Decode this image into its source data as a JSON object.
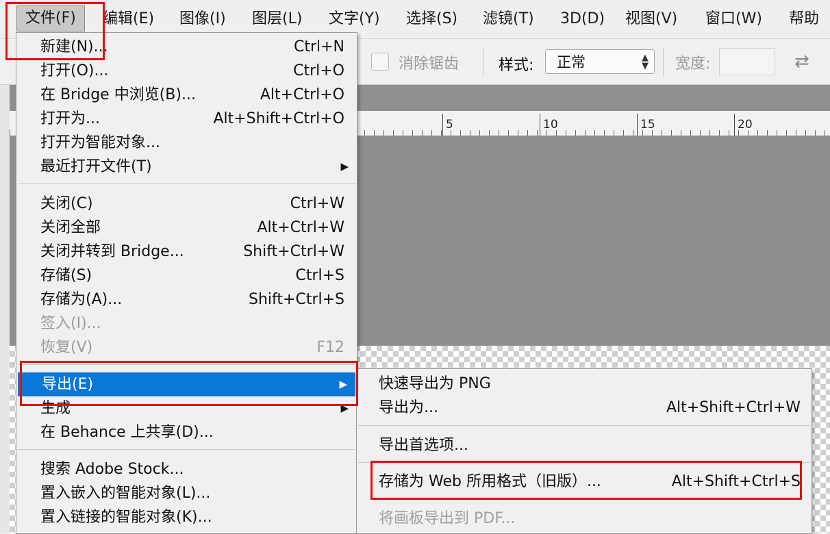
{
  "menubar": {
    "items": [
      {
        "label": "文件(F)"
      },
      {
        "label": "编辑(E)"
      },
      {
        "label": "图像(I)"
      },
      {
        "label": "图层(L)"
      },
      {
        "label": "文字(Y)"
      },
      {
        "label": "选择(S)"
      },
      {
        "label": "滤镜(T)"
      },
      {
        "label": "3D(D)"
      },
      {
        "label": "视图(V)"
      },
      {
        "label": "窗口(W)"
      },
      {
        "label": "帮助"
      }
    ]
  },
  "options": {
    "anti_alias_label": "消除锯齿",
    "anti_alias_checked": false,
    "style_label": "样式:",
    "style_value": "正常",
    "width_label": "宽度:",
    "width_value": ""
  },
  "ruler": {
    "labels": [
      "5",
      "10",
      "15",
      "20"
    ]
  },
  "file_menu": {
    "items": [
      {
        "label": "新建(N)...",
        "shortcut": "Ctrl+N"
      },
      {
        "label": "打开(O)...",
        "shortcut": "Ctrl+O"
      },
      {
        "label": "在 Bridge 中浏览(B)...",
        "shortcut": "Alt+Ctrl+O"
      },
      {
        "label": "打开为...",
        "shortcut": "Alt+Shift+Ctrl+O"
      },
      {
        "label": "打开为智能对象...",
        "shortcut": ""
      },
      {
        "label": "最近打开文件(T)",
        "shortcut": ""
      },
      {
        "label": "关闭(C)",
        "shortcut": "Ctrl+W"
      },
      {
        "label": "关闭全部",
        "shortcut": "Alt+Ctrl+W"
      },
      {
        "label": "关闭并转到 Bridge...",
        "shortcut": "Shift+Ctrl+W"
      },
      {
        "label": "存储(S)",
        "shortcut": "Ctrl+S"
      },
      {
        "label": "存储为(A)...",
        "shortcut": "Shift+Ctrl+S"
      },
      {
        "label": "签入(I)...",
        "shortcut": ""
      },
      {
        "label": "恢复(V)",
        "shortcut": "F12"
      },
      {
        "label": "导出(E)",
        "shortcut": ""
      },
      {
        "label": "生成",
        "shortcut": ""
      },
      {
        "label": "在 Behance 上共享(D)...",
        "shortcut": ""
      },
      {
        "label": "搜索 Adobe Stock...",
        "shortcut": ""
      },
      {
        "label": "置入嵌入的智能对象(L)...",
        "shortcut": ""
      },
      {
        "label": "置入链接的智能对象(K)...",
        "shortcut": ""
      }
    ]
  },
  "export_submenu": {
    "items": [
      {
        "label": "快速导出为 PNG",
        "shortcut": ""
      },
      {
        "label": "导出为...",
        "shortcut": "Alt+Shift+Ctrl+W"
      },
      {
        "label": "导出首选项...",
        "shortcut": ""
      },
      {
        "label": "存储为 Web 所用格式（旧版）...",
        "shortcut": "Alt+Shift+Ctrl+S"
      },
      {
        "label": "将画板导出到 PDF...",
        "shortcut": ""
      }
    ]
  },
  "colors": {
    "highlight": "#0a78d7",
    "annotation": "#e01010",
    "workspace": "#8d8d8d"
  }
}
